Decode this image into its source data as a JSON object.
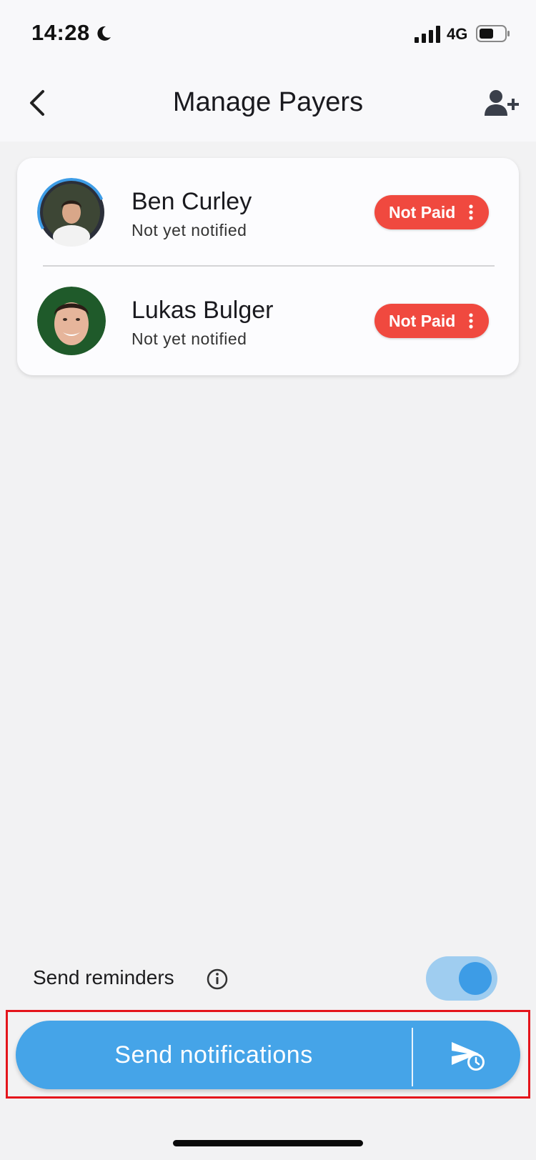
{
  "status_bar": {
    "time": "14:28",
    "network": "4G",
    "icons": [
      "moon-icon",
      "signal-icon",
      "battery-icon"
    ]
  },
  "nav": {
    "title": "Manage Payers",
    "back_icon": "chevron-left-icon",
    "add_icon": "add-user-icon"
  },
  "payers": [
    {
      "name": "Ben Curley",
      "status": "Not yet notified",
      "badge": "Not Paid"
    },
    {
      "name": "Lukas Bulger",
      "status": "Not yet notified",
      "badge": "Not Paid"
    }
  ],
  "reminders": {
    "label": "Send reminders",
    "enabled": true,
    "info_icon": "info-icon"
  },
  "footer": {
    "send_label": "Send notifications",
    "schedule_icon": "schedule-send-icon"
  },
  "colors": {
    "accent": "#45a4e8",
    "badge": "#f0493f",
    "toggle_track": "#9fcdf0",
    "toggle_knob": "#3d9ce6",
    "highlight": "#e4141b"
  }
}
